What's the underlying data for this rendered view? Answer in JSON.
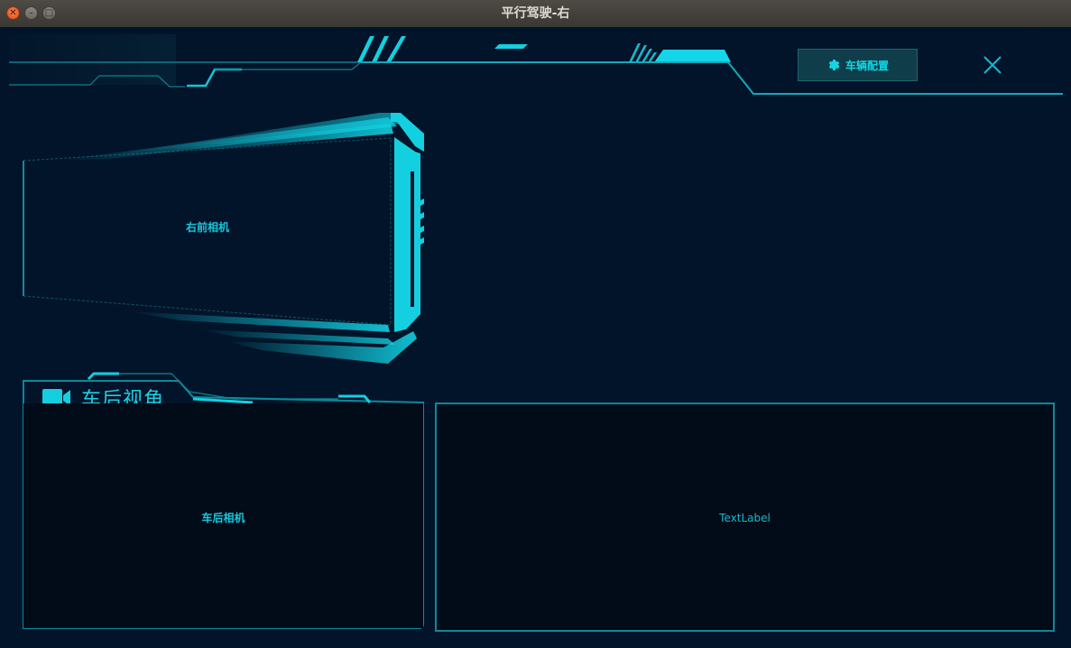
{
  "window": {
    "title": "平行驾驶-右",
    "buttons": {
      "close": "✕",
      "minimize": "–",
      "maximize": "□"
    }
  },
  "header": {
    "config_button": {
      "label": "车辆配置",
      "icon": "gear-icon"
    },
    "close_icon": "close-icon"
  },
  "front_camera": {
    "label": "右前相机"
  },
  "rear_view": {
    "title": "车后视角",
    "icon": "video-camera-icon",
    "camera_label": "车后相机"
  },
  "right_panel": {
    "label": "TextLabel"
  },
  "colors": {
    "background": "#02142a",
    "accent": "#11d6e6",
    "panel": "#020c18",
    "border": "#0e8898"
  }
}
